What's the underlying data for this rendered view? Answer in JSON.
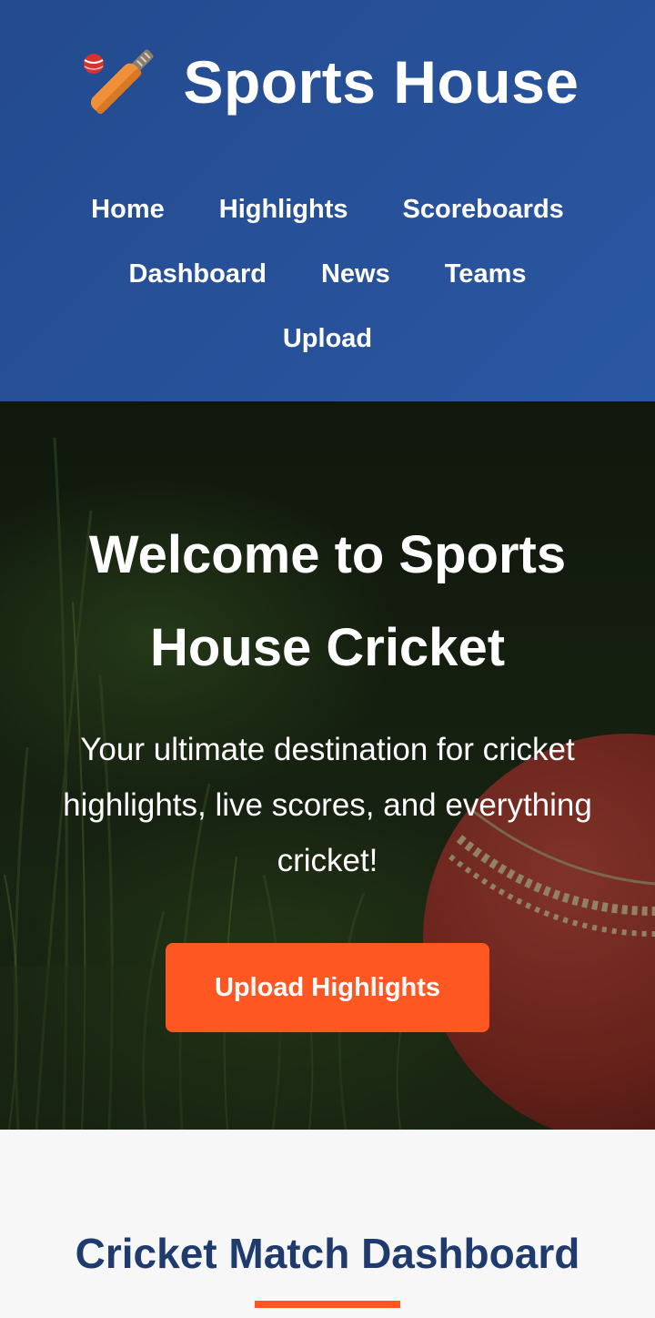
{
  "header": {
    "brand_title": "Sports House",
    "brand_icon": "cricket-bat-ball-icon",
    "nav_row1": [
      {
        "label": "Home"
      },
      {
        "label": "Highlights"
      },
      {
        "label": "Scoreboards"
      }
    ],
    "nav_row2": [
      {
        "label": "Dashboard"
      },
      {
        "label": "News"
      },
      {
        "label": "Teams"
      }
    ],
    "nav_row3": [
      {
        "label": "Upload"
      }
    ]
  },
  "hero": {
    "title": "Welcome to Sports House Cricket",
    "subtitle": "Your ultimate destination for cricket highlights, live scores, and everything cricket!",
    "cta_label": "Upload Highlights"
  },
  "dashboard": {
    "title": "Cricket Match Dashboard"
  },
  "colors": {
    "header_bg": "#2a57a3",
    "accent": "#ff5722",
    "dashboard_title": "#1f3b6e"
  }
}
